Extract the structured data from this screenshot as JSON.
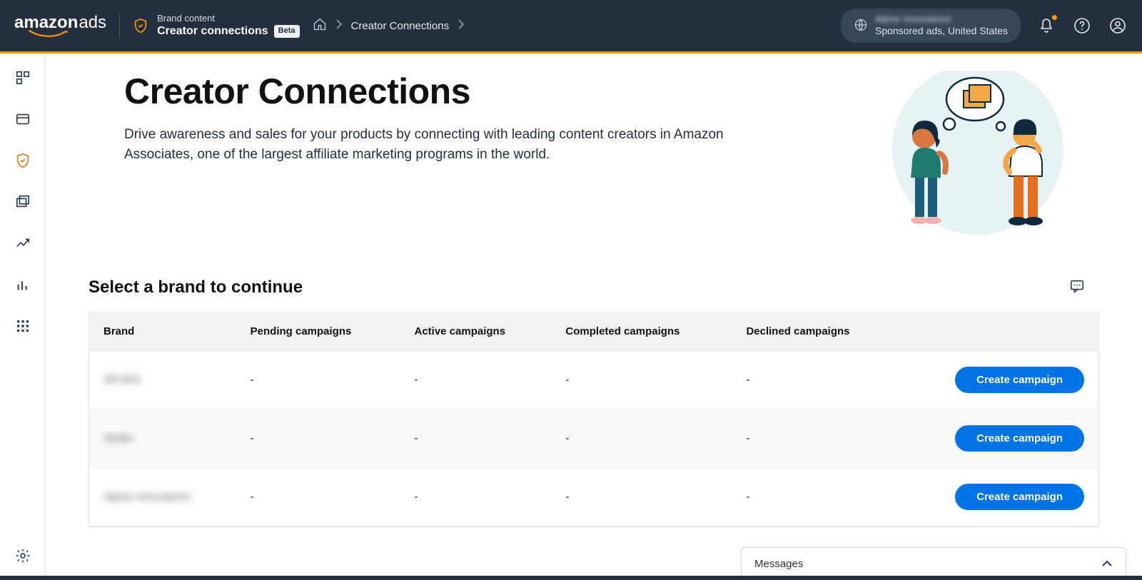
{
  "header": {
    "logo_bold": "amazon",
    "logo_thin": "ads",
    "brand_sup": "Brand content",
    "brand_main": "Creator connections",
    "beta": "Beta",
    "breadcrumb": "Creator Connections",
    "account_name_blurred": "Alpine Innovations",
    "account_line": "Sponsored ads, United States"
  },
  "hero": {
    "title": "Creator Connections",
    "body": "Drive awareness and sales for your products by connecting with leading content creators in Amazon Associates, one of the largest affiliate marketing programs in the world."
  },
  "section": {
    "title": "Select a brand to continue"
  },
  "table": {
    "headers": {
      "brand": "Brand",
      "pending": "Pending campaigns",
      "active": "Active campaigns",
      "completed": "Completed campaigns",
      "declined": "Declined campaigns"
    },
    "rows": [
      {
        "brand_blurred": "SPURS",
        "pending": "-",
        "active": "-",
        "completed": "-",
        "declined": "-",
        "button": "Create campaign"
      },
      {
        "brand_blurred": "Stolen",
        "pending": "-",
        "active": "-",
        "completed": "-",
        "declined": "-",
        "button": "Create campaign"
      },
      {
        "brand_blurred": "Alpine Innovations",
        "pending": "-",
        "active": "-",
        "completed": "-",
        "declined": "-",
        "button": "Create campaign"
      }
    ]
  },
  "messages": {
    "label": "Messages"
  }
}
